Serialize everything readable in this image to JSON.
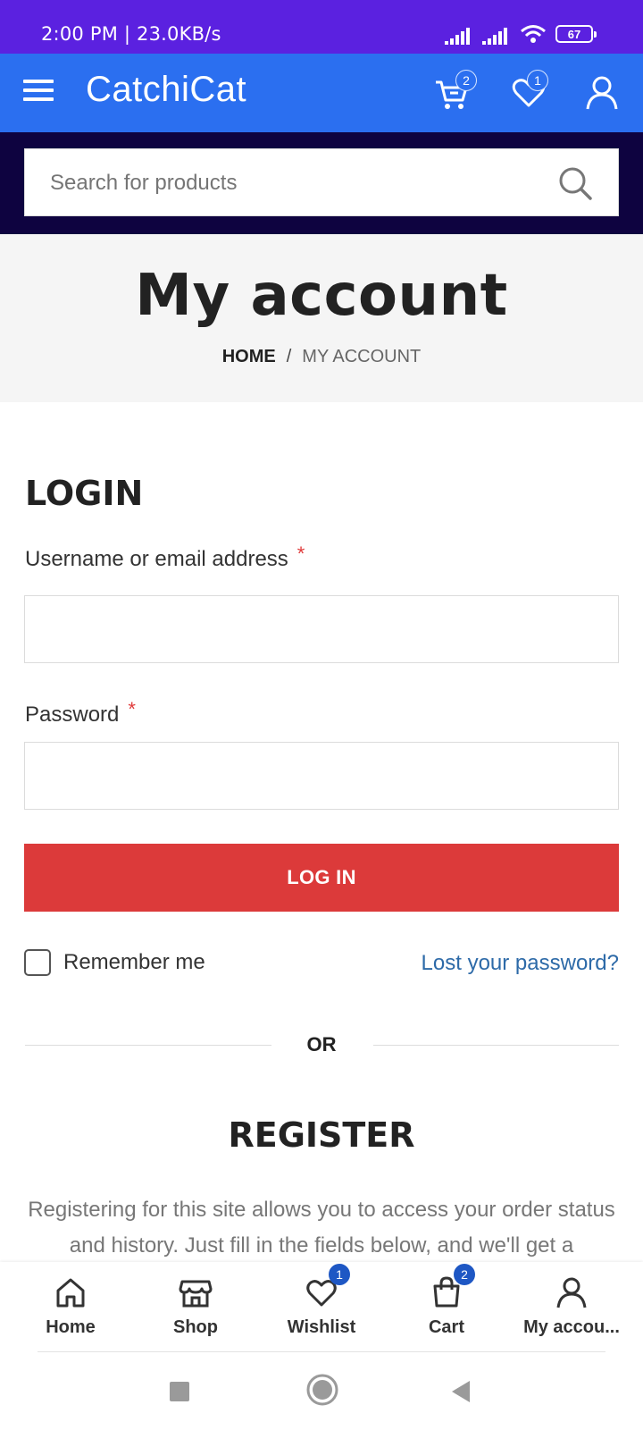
{
  "status_bar": {
    "time": "2:00 PM | 23.0KB/s",
    "battery": "67"
  },
  "header": {
    "logo": "CatchiCat",
    "cart_count": "2",
    "wishlist_count": "1"
  },
  "search": {
    "placeholder": "Search for products"
  },
  "page": {
    "title": "My account",
    "breadcrumb_home": "HOME",
    "breadcrumb_separator": "/",
    "breadcrumb_current": "MY ACCOUNT"
  },
  "login": {
    "heading": "LOGIN",
    "username_label": "Username or email address",
    "password_label": "Password",
    "required_marker": "*",
    "button_label": "LOG IN",
    "remember_label": "Remember me",
    "lost_password": "Lost your password?"
  },
  "divider_text": "OR",
  "register": {
    "heading": "REGISTER",
    "text": "Registering for this site allows you to access your order status and history. Just fill in the fields below, and we'll get a"
  },
  "bottom_nav": {
    "items": [
      {
        "label": "Home",
        "icon": "home-icon"
      },
      {
        "label": "Shop",
        "icon": "shop-icon"
      },
      {
        "label": "Wishlist",
        "icon": "heart-icon",
        "badge": "1"
      },
      {
        "label": "Cart",
        "icon": "bag-icon",
        "badge": "2"
      },
      {
        "label": "My accou...",
        "icon": "user-icon"
      }
    ]
  },
  "colors": {
    "status_bar": "#5b21e0",
    "header": "#2b6ff0",
    "search_band": "#0e0340",
    "login_button": "#dc3a3a",
    "link": "#2d6aa8"
  }
}
